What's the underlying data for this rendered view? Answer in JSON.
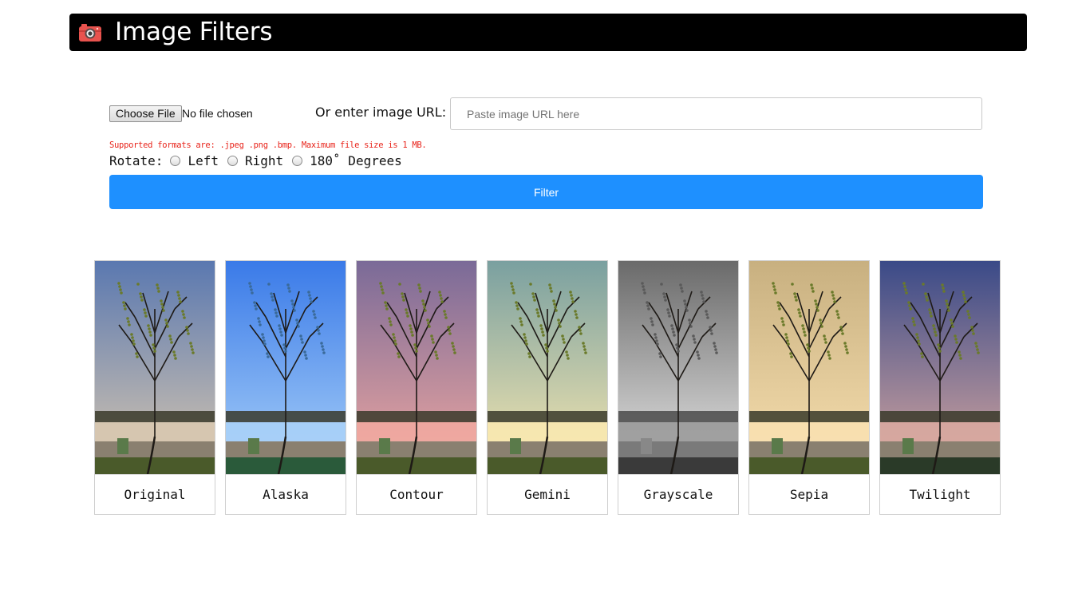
{
  "header": {
    "title": "Image Filters",
    "logo_icon": "camera-icon",
    "logo_color": "#e8534e"
  },
  "upload": {
    "choose_file_label": "Choose File",
    "file_status": "No file chosen",
    "url_label": "Or enter image URL:",
    "url_placeholder": "Paste image URL here",
    "url_value": "",
    "hint": "Supported formats are: .jpeg .png .bmp. Maximum file size is 1 MB."
  },
  "rotate": {
    "label": "Rotate:",
    "options": [
      "Left",
      "Right",
      "180˚ Degrees"
    ],
    "selected": null
  },
  "filter_button": {
    "label": "Filter",
    "color": "#1e90ff"
  },
  "filters": [
    {
      "name": "Original",
      "sky_top": "#5a78b0",
      "sky_bottom": "#d8c8b0"
    },
    {
      "name": "Alaska",
      "sky_top": "#3a7ae8",
      "sky_bottom": "#a8d0f8"
    },
    {
      "name": "Contour",
      "sky_top": "#7a6a98",
      "sky_bottom": "#f0a8a0"
    },
    {
      "name": "Gemini",
      "sky_top": "#7aa0a0",
      "sky_bottom": "#f8e8b0"
    },
    {
      "name": "Grayscale",
      "sky_top": "#6a6a6a",
      "sky_bottom": "#e8e8e8"
    },
    {
      "name": "Sepia",
      "sky_top": "#c8b080",
      "sky_bottom": "#f8e0b0"
    },
    {
      "name": "Twilight",
      "sky_top": "#3a4a88",
      "sky_bottom": "#d8a8a0"
    }
  ]
}
